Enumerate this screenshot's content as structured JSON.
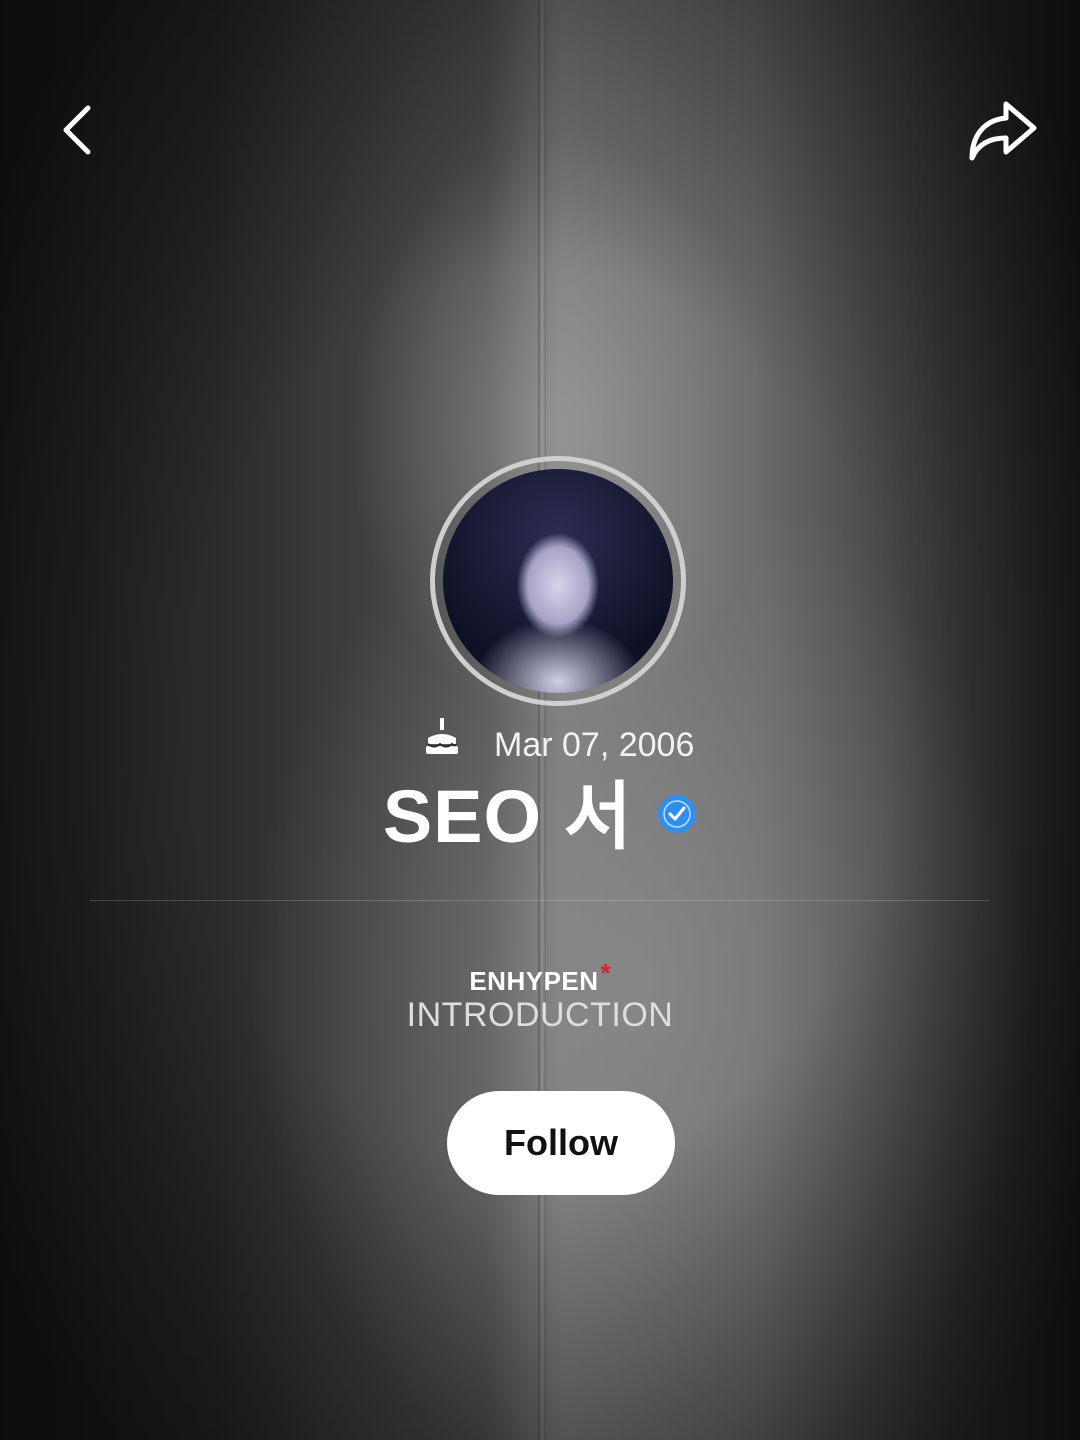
{
  "profile": {
    "birthday": "Mar 07, 2006",
    "name": "SEO 서",
    "verified": true,
    "group": "ENHYPEN",
    "group_mark": "*",
    "intro_label": "INTRODUCTION"
  },
  "actions": {
    "follow_label": "Follow"
  },
  "icons": {
    "back": "chevron-left-icon",
    "share": "share-icon",
    "cake": "cake-icon",
    "verified": "verified-badge-icon"
  },
  "colors": {
    "verified_blue": "#2f8ff0",
    "accent_red": "#d8242c",
    "button_bg": "#ffffff"
  }
}
